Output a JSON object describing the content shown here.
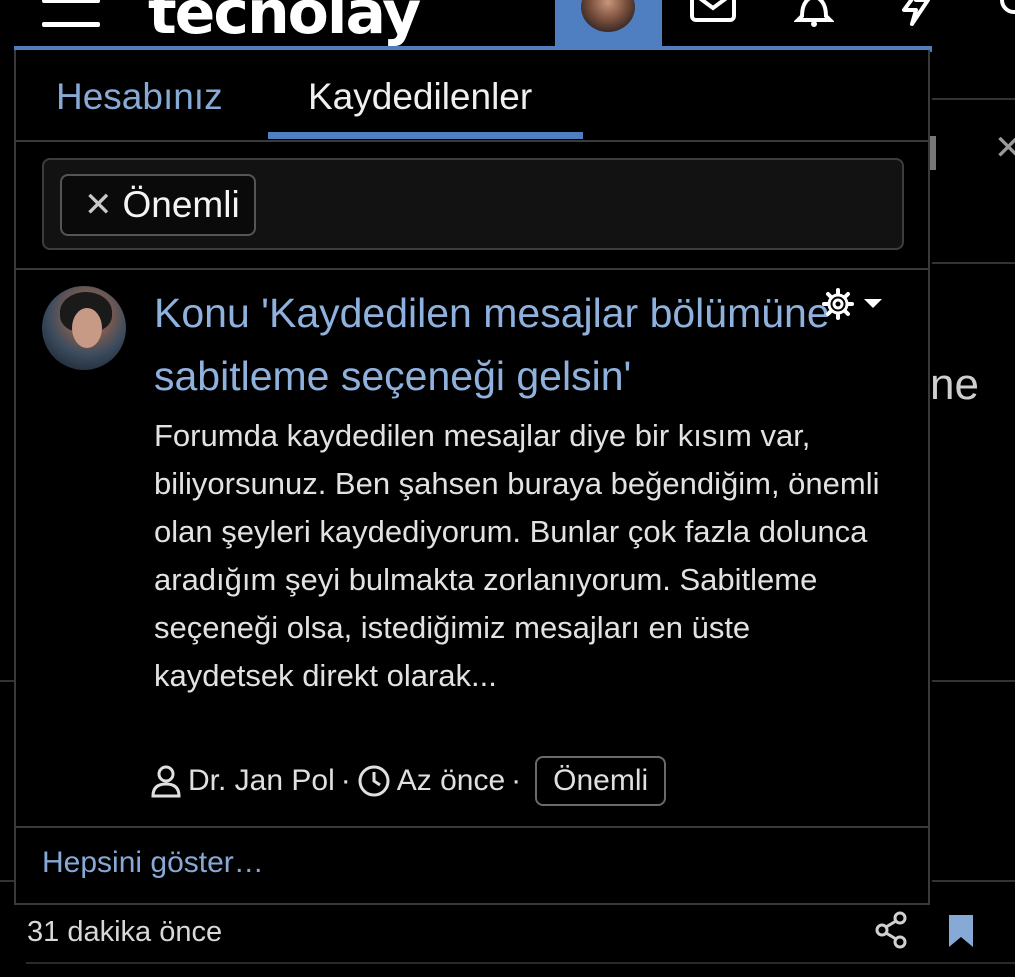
{
  "header": {
    "logo_text": "tecnolay",
    "icons": [
      "menu-icon",
      "avatar",
      "mail-icon",
      "bell-icon",
      "lightning-icon",
      "search-icon"
    ],
    "accent_color": "#4f7fc0"
  },
  "background": {
    "fragment_text": "ne",
    "post_time": "31 dakika önce"
  },
  "panel": {
    "tabs": [
      {
        "label": "Hesabınız",
        "active": false
      },
      {
        "label": "Kaydedilenler",
        "active": true
      }
    ],
    "filter": {
      "chip_label": "Önemli",
      "remove_symbol": "✕"
    },
    "result": {
      "title": "Konu 'Kaydedilen mesajlar bölümüne sabitleme seçeneği gelsin'",
      "snippet": "Forumda kaydedilen mesajlar diye bir kısım var, biliyorsunuz. Ben şahsen buraya beğendiğim, önemli olan şeyleri kaydediyorum. Bunlar çok fazla dolunca aradığım şeyi bulmakta zorlanıyorum. Sabitleme seçeneği olsa, istediğimiz mesajları en üste kaydetsek direkt olarak...",
      "author": "Dr. Jan Pol",
      "time": "Az önce",
      "tag": "Önemli",
      "separator": "·"
    },
    "show_all_label": "Hepsini göster…"
  }
}
